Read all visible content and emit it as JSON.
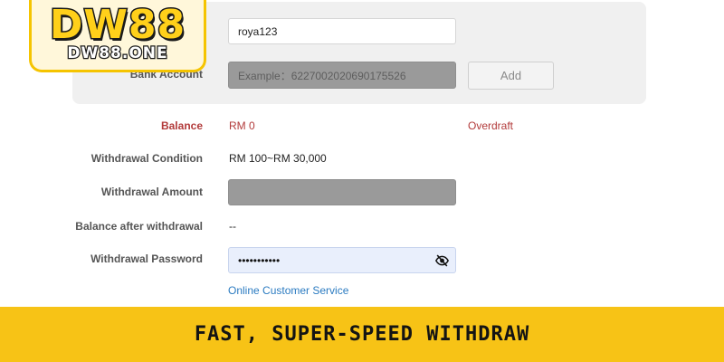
{
  "logo": {
    "main": "DW88",
    "sub": "DW88.ONE"
  },
  "account_panel": {
    "username_value": "roya123",
    "bank_account_label": "Bank Account",
    "bank_account_placeholder": "Example：6227002020690175526",
    "add_button_label": "Add"
  },
  "form": {
    "balance_label": "Balance",
    "balance_value": "RM 0",
    "overdraft_label": "Overdraft",
    "withdrawal_condition_label": "Withdrawal Condition",
    "withdrawal_condition_value": "RM 100~RM 30,000",
    "withdrawal_amount_label": "Withdrawal Amount",
    "withdrawal_amount_value": "",
    "balance_after_label": "Balance after withdrawal",
    "balance_after_value": "--",
    "password_label": "Withdrawal Password",
    "password_value": "•••••••••••",
    "customer_service_link": "Online Customer Service"
  },
  "banner": {
    "text": "FAST, SUPER-SPEED WITHDRAW"
  },
  "colors": {
    "accent_red": "#b23a3a",
    "link_blue": "#2b7bc1",
    "banner_yellow": "#f7c316"
  }
}
